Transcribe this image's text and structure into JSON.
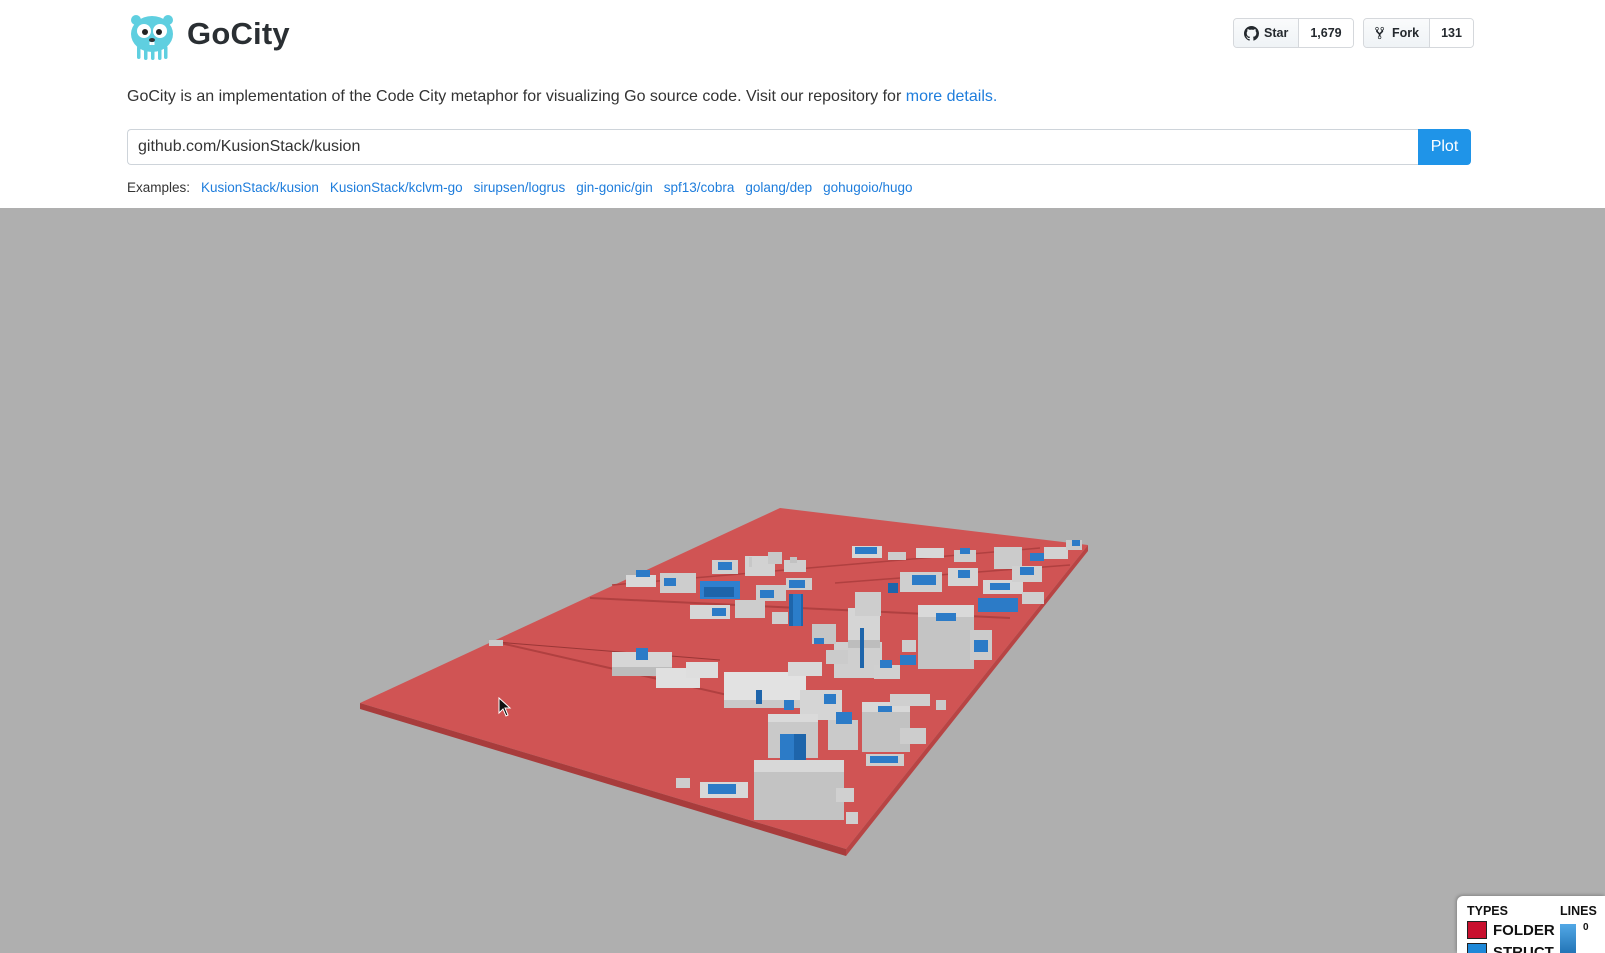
{
  "app": {
    "brand": "GoCity",
    "logo_icon": "gopher-logo-icon",
    "brand_color": "#5fcfe0"
  },
  "github": {
    "star_label": "Star",
    "star_count": "1,679",
    "fork_label": "Fork",
    "fork_count": "131"
  },
  "description": {
    "text": "GoCity is an implementation of the Code City metaphor for visualizing Go source code. Visit our repository for ",
    "link": "more details."
  },
  "search": {
    "value": "github.com/KusionStack/kusion",
    "button": "Plot"
  },
  "examples": {
    "label": "Examples:",
    "items": [
      "KusionStack/kusion",
      "KusionStack/kclvm-go",
      "sirupsen/logrus",
      "gin-gonic/gin",
      "spf13/cobra",
      "golang/dep",
      "gohugoio/hugo"
    ]
  },
  "legend": {
    "types_title": "TYPES",
    "lines_title": "LINES",
    "types": [
      {
        "label": "FOLDER",
        "color": "#c8102e"
      },
      {
        "label": "STRUCT",
        "color": "#1e88d8"
      }
    ],
    "lines_min": "0"
  },
  "colors": {
    "accent": "#1f94e8",
    "link": "#1e7ddc",
    "canvas_bg": "#afafaf",
    "folder_plane": "#c95050",
    "building_gray": "#cfcfcf",
    "struct_blue": "#2a78c4"
  }
}
